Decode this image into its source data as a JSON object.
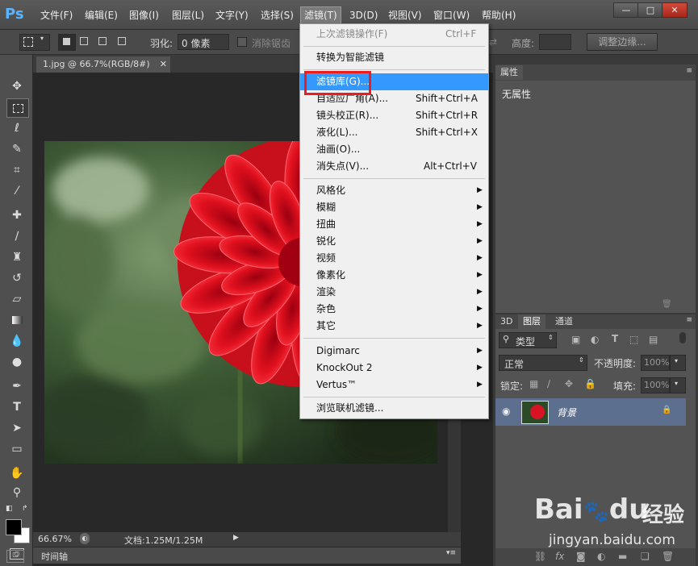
{
  "app": {
    "logo": "Ps"
  },
  "menubar": {
    "items": [
      "文件(F)",
      "编辑(E)",
      "图像(I)",
      "图层(L)",
      "文字(Y)",
      "选择(S)",
      "滤镜(T)",
      "3D(D)",
      "视图(V)",
      "窗口(W)",
      "帮助(H)"
    ],
    "active_index": 6
  },
  "options": {
    "feather_label": "羽化:",
    "feather_value": "0 像素",
    "antialias_label": "消除锯齿",
    "height_label": "高度:",
    "refine_button": "调整边缘..."
  },
  "document": {
    "tab_title": "1.jpg @ 66.7%(RGB/8#)",
    "zoom": "66.67%",
    "doc_info": "文档:1.25M/1.25M"
  },
  "timeline": {
    "label": "时间轴"
  },
  "properties_panel": {
    "tab": "属性",
    "content": "无属性"
  },
  "layers_panel": {
    "tabs": [
      "3D",
      "图层",
      "通道"
    ],
    "active_tab": 1,
    "filter_kind": "类型",
    "blend_mode": "正常",
    "opacity_label": "不透明度:",
    "opacity_value": "100%",
    "lock_label": "锁定:",
    "fill_label": "填充:",
    "fill_value": "100%",
    "layer_name": "背景"
  },
  "filter_menu": {
    "last_filter": {
      "label": "上次滤镜操作(F)",
      "shortcut": "Ctrl+F"
    },
    "smart": "转换为智能滤镜",
    "gallery": "滤镜库(G)...",
    "adaptive_wide": {
      "label": "自适应广角(A)...",
      "shortcut": "Shift+Ctrl+A"
    },
    "lens_correction": {
      "label": "镜头校正(R)...",
      "shortcut": "Shift+Ctrl+R"
    },
    "liquify": {
      "label": "液化(L)...",
      "shortcut": "Shift+Ctrl+X"
    },
    "oil_paint": {
      "label": "油画(O)..."
    },
    "vanishing_point": {
      "label": "消失点(V)...",
      "shortcut": "Alt+Ctrl+V"
    },
    "submenus": [
      "风格化",
      "模糊",
      "扭曲",
      "锐化",
      "视频",
      "像素化",
      "渲染",
      "杂色",
      "其它"
    ],
    "plugins": [
      "Digimarc",
      "KnockOut 2",
      "Vertus™"
    ],
    "browse": "浏览联机滤镜..."
  },
  "watermark": {
    "brand": "Bai",
    "brand_tail": "du",
    "product": "经验",
    "url": "jingyan.baidu.com"
  },
  "colors": {
    "highlight": "#3399ff",
    "callout": "#ee1c1c",
    "ps_blue": "#5ab4ff"
  }
}
